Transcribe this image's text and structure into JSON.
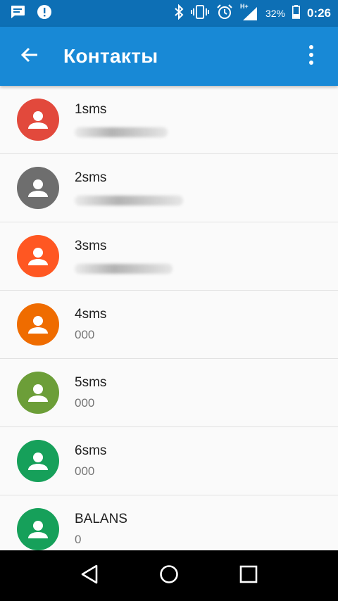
{
  "status_bar": {
    "icons_left": [
      "chat-notification-icon",
      "alert-icon"
    ],
    "icons_right": [
      "bluetooth-icon",
      "vibrate-icon",
      "alarm-icon",
      "signal-icon"
    ],
    "network_type": "H+",
    "battery": "32%",
    "time": "0:26"
  },
  "app_bar": {
    "title": "Контакты",
    "back_icon": "arrow-back-icon",
    "menu_icon": "more-vert-icon",
    "color": "#1889d6"
  },
  "contacts": [
    {
      "name": "1sms",
      "number": "",
      "number_blurred": true,
      "avatar_color": "#e2493c",
      "blur_width_pct": 60
    },
    {
      "name": "2sms",
      "number": "",
      "number_blurred": true,
      "avatar_color": "#6e6e6e",
      "blur_width_pct": 70
    },
    {
      "name": "3sms",
      "number": "",
      "number_blurred": true,
      "avatar_color": "#ff5722",
      "blur_width_pct": 63
    },
    {
      "name": "4sms",
      "number": "000",
      "number_blurred": false,
      "avatar_color": "#ef6c00"
    },
    {
      "name": "5sms",
      "number": "000",
      "number_blurred": false,
      "avatar_color": "#6c9e38"
    },
    {
      "name": "6sms",
      "number": "000",
      "number_blurred": false,
      "avatar_color": "#16a05a"
    },
    {
      "name": "BALANS",
      "number": "0",
      "number_blurred": false,
      "avatar_color": "#16a05a"
    }
  ],
  "nav_bar": {
    "back": "nav-back-icon",
    "home": "nav-home-icon",
    "recents": "nav-recents-icon"
  }
}
